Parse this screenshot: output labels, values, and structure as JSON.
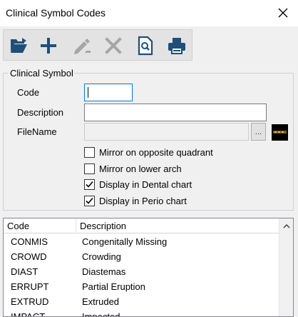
{
  "window": {
    "title": "Clinical Symbol Codes",
    "close_icon": "close-icon"
  },
  "toolbar": {
    "buttons": [
      {
        "name": "open-folder",
        "icon": "folder-open-icon"
      },
      {
        "name": "add",
        "icon": "plus-icon"
      },
      {
        "name": "edit",
        "icon": "pencil-icon",
        "enabled": false
      },
      {
        "name": "delete",
        "icon": "x-icon",
        "enabled": false
      },
      {
        "name": "preview",
        "icon": "document-search-icon"
      },
      {
        "name": "print",
        "icon": "printer-icon"
      }
    ]
  },
  "form": {
    "group_label": "Clinical Symbol",
    "code_label": "Code",
    "code_value": "",
    "description_label": "Description",
    "description_value": "",
    "filename_label": "FileName",
    "filename_value": "",
    "browse_label": "...",
    "checkboxes": [
      {
        "label": "Mirror on opposite quadrant",
        "checked": false
      },
      {
        "label": "Mirror on lower arch",
        "checked": false
      },
      {
        "label": "Display in Dental chart",
        "checked": true
      },
      {
        "label": "Display in Perio chart",
        "checked": true
      }
    ]
  },
  "grid": {
    "columns": [
      "Code",
      "Description"
    ],
    "rows": [
      [
        "CONMIS",
        "Congenitally Missing"
      ],
      [
        "CROWD",
        "Crowding"
      ],
      [
        "DIAST",
        "Diastemas"
      ],
      [
        "ERRUPT",
        "Partial Eruption"
      ],
      [
        "EXTRUD",
        "Extruded"
      ],
      [
        "IMPACT",
        "Impacted"
      ]
    ]
  },
  "colors": {
    "toolbar_icon": "#1f4e79",
    "disabled_icon": "#a6a6a6",
    "focus_border": "#0078d7"
  }
}
